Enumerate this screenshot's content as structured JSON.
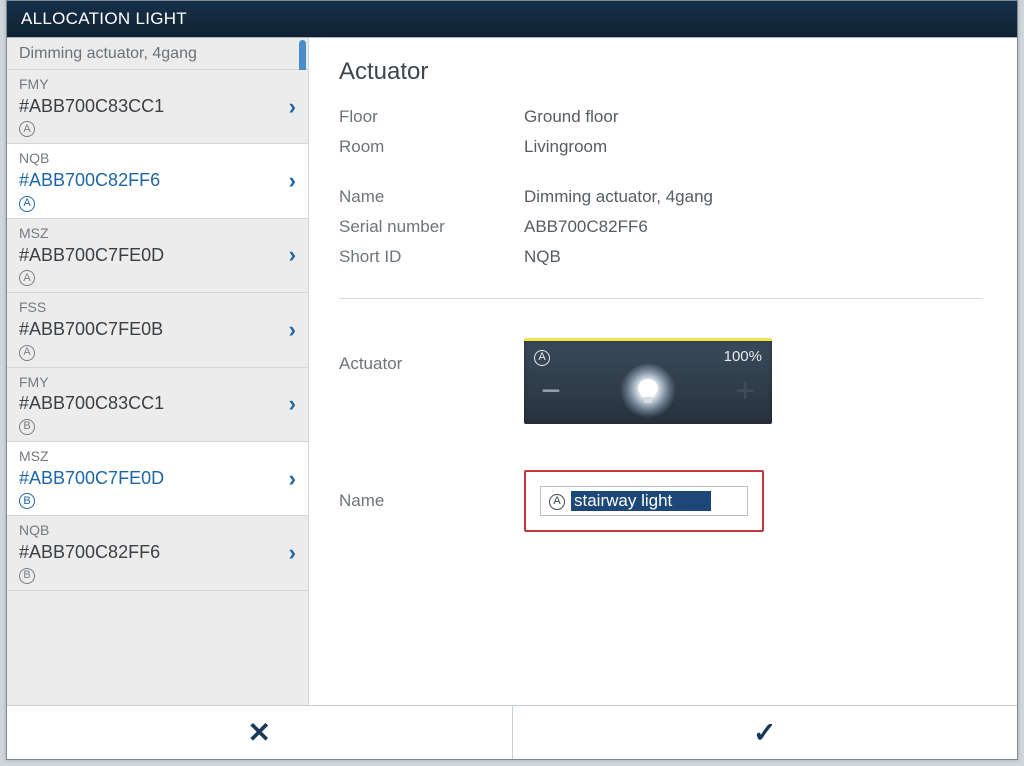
{
  "window": {
    "title": "ALLOCATION LIGHT"
  },
  "sidebar": {
    "header": "Dimming actuator, 4gang",
    "items": [
      {
        "short": "FMY",
        "serial": "#ABB700C83CC1",
        "channel": "A",
        "selected": false
      },
      {
        "short": "NQB",
        "serial": "#ABB700C82FF6",
        "channel": "A",
        "selected": true
      },
      {
        "short": "MSZ",
        "serial": "#ABB700C7FE0D",
        "channel": "A",
        "selected": false
      },
      {
        "short": "FSS",
        "serial": "#ABB700C7FE0B",
        "channel": "A",
        "selected": false
      },
      {
        "short": "FMY",
        "serial": "#ABB700C83CC1",
        "channel": "B",
        "selected": false
      },
      {
        "short": "MSZ",
        "serial": "#ABB700C7FE0D",
        "channel": "B",
        "selected": true
      },
      {
        "short": "NQB",
        "serial": "#ABB700C82FF6",
        "channel": "B",
        "selected": false
      }
    ]
  },
  "details": {
    "heading": "Actuator",
    "labels": {
      "floor": "Floor",
      "room": "Room",
      "name": "Name",
      "serial": "Serial number",
      "shortid": "Short ID",
      "actuator": "Actuator",
      "name2": "Name"
    },
    "floor": "Ground floor",
    "room": "Livingroom",
    "name": "Dimming actuator, 4gang",
    "serial": "ABB700C82FF6",
    "shortid": "NQB",
    "widget": {
      "channel": "A",
      "level": "100%"
    },
    "edit": {
      "channel": "A",
      "value": "stairway light"
    }
  },
  "footer": {
    "cancel": "✕",
    "confirm": "✓"
  }
}
